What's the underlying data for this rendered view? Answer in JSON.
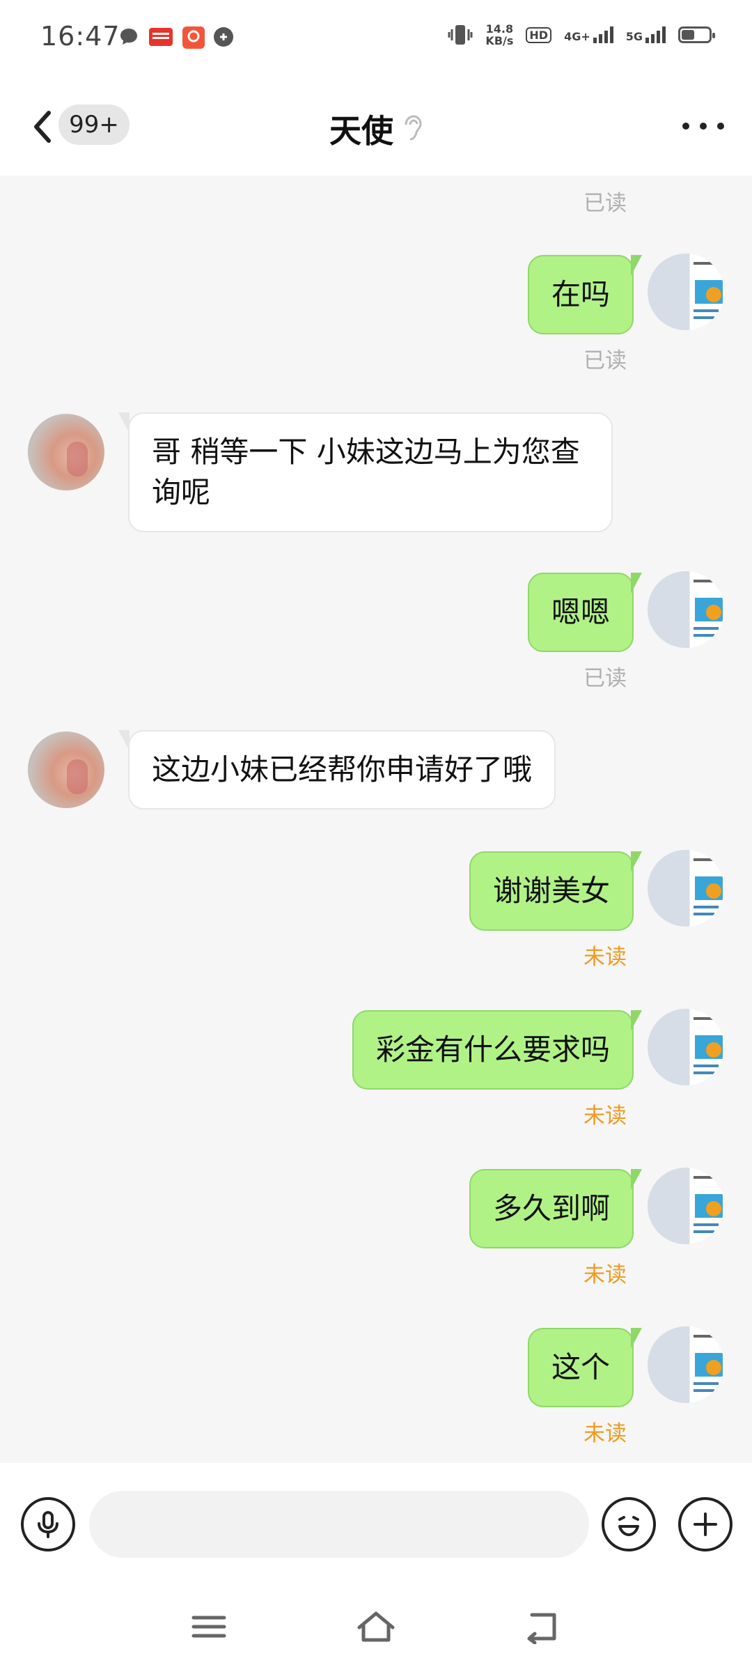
{
  "status_bar": {
    "time": "16:47",
    "netspeed_value": "14.8",
    "netspeed_unit": "KB/s",
    "hd_label": "HD",
    "sim1_label": "4G+",
    "sim2_label": "5G",
    "notification_icons": [
      "chat-bubble-icon",
      "toutiao-app-icon",
      "app-icon",
      "game-icon"
    ]
  },
  "header": {
    "back_badge": "99+",
    "title": "天使"
  },
  "messages": [
    {
      "side": "me",
      "status": "已读"
    },
    {
      "side": "me",
      "text": "在吗",
      "status": "已读"
    },
    {
      "side": "other",
      "text": "哥 稍等一下 小妹这边马上为您查询呢"
    },
    {
      "side": "me",
      "text": "嗯嗯",
      "status": "已读"
    },
    {
      "side": "other",
      "text": "这边小妹已经帮你申请好了哦"
    },
    {
      "side": "me",
      "text": "谢谢美女",
      "status": "未读"
    },
    {
      "side": "me",
      "text": "彩金有什么要求吗",
      "status": "未读"
    },
    {
      "side": "me",
      "text": "多久到啊",
      "status": "未读"
    },
    {
      "side": "me",
      "text": "这个",
      "status": "未读"
    }
  ],
  "input": {
    "placeholder": "",
    "value": ""
  },
  "colors": {
    "my_bubble": "#b1f287",
    "unread_status": "#f29a1f",
    "read_status": "#b0b0b0"
  }
}
